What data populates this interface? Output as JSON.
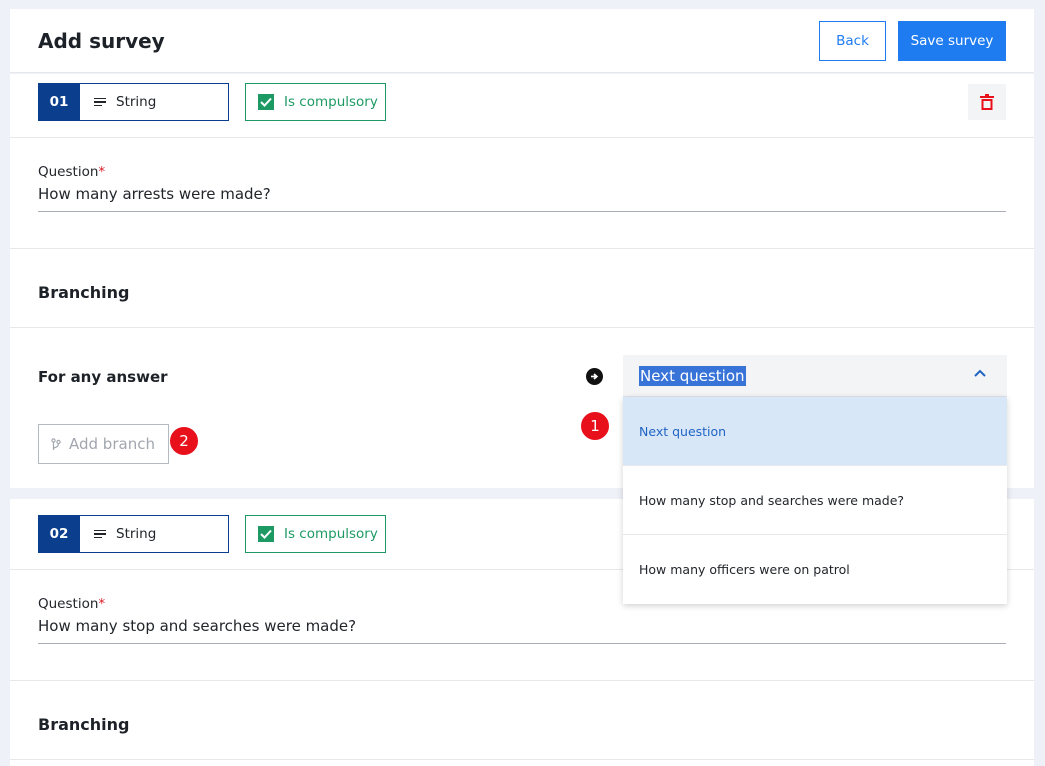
{
  "header": {
    "title": "Add survey",
    "back_label": "Back",
    "save_label": "Save survey"
  },
  "questions": [
    {
      "number": "01",
      "type_label": "String",
      "compulsory_label": "Is compulsory",
      "question_label": "Question",
      "required_marker": "*",
      "question_value": "How many arrests were made?",
      "branching_title": "Branching",
      "for_any_answer_label": "For any answer",
      "add_branch_label": "Add branch"
    },
    {
      "number": "02",
      "type_label": "String",
      "compulsory_label": "Is compulsory",
      "question_label": "Question",
      "required_marker": "*",
      "question_value": "How many stop and searches were made?",
      "branching_title": "Branching"
    }
  ],
  "dropdown": {
    "selected": "Next question",
    "options": [
      "Next question",
      "How many stop and searches were made?",
      "How many officers were on patrol"
    ]
  },
  "annotations": {
    "badge_1": "1",
    "badge_2": "2"
  },
  "colors": {
    "primary": "#1f7cf0",
    "navy": "#0b3f8e",
    "success": "#1d9a63",
    "danger": "#da1e28",
    "option_highlight": "#d8e7f8"
  },
  "icons": {
    "type": "lines-icon",
    "compulsory": "checkbox-checked-icon",
    "delete": "trash-icon",
    "next": "arrow-right-circle-icon",
    "branch": "branch-icon",
    "dropdown": "chevron-up-icon"
  }
}
